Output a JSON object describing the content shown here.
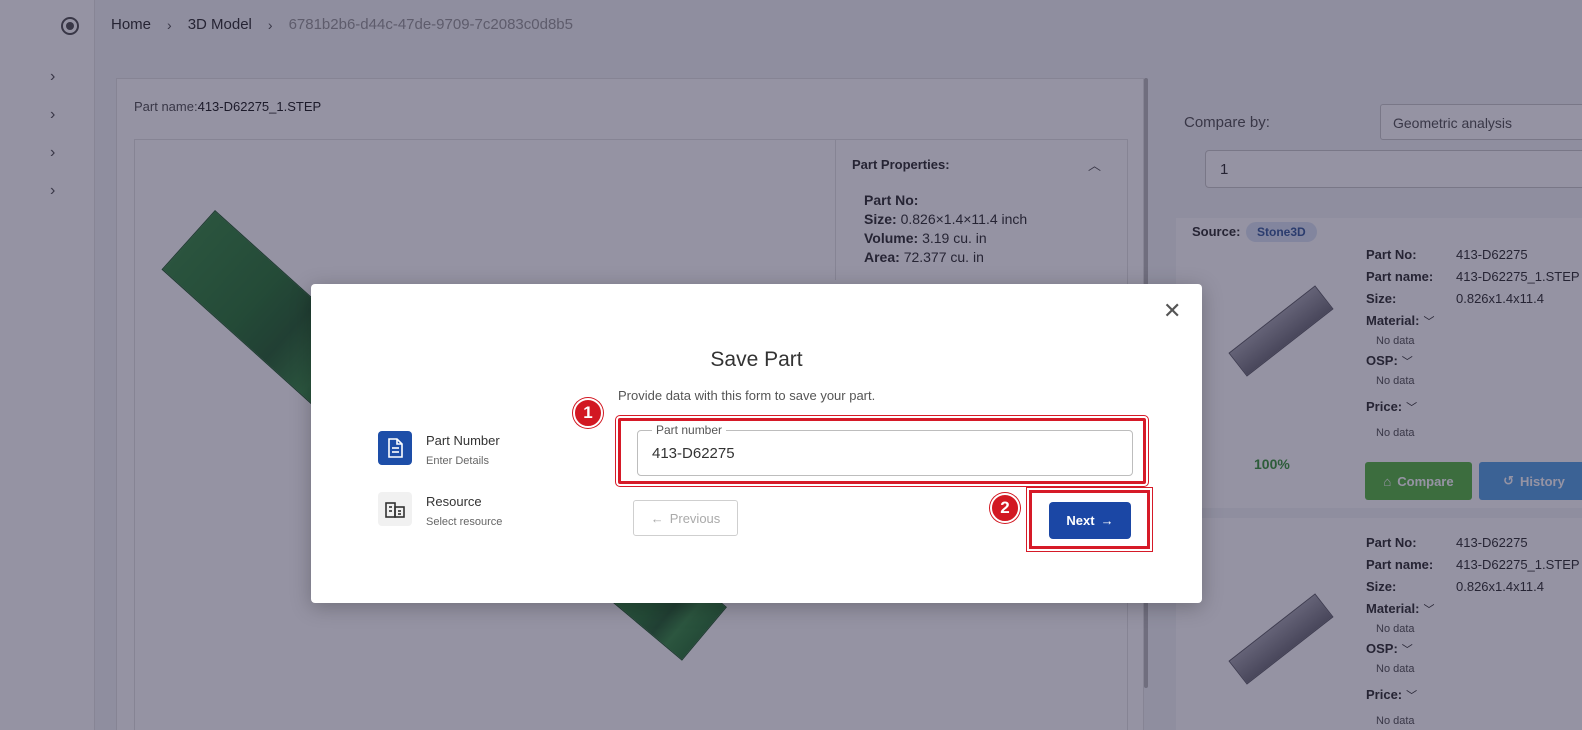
{
  "breadcrumb": {
    "home": "Home",
    "model": "3D Model",
    "current": "6781b2b6-d44c-47de-9709-7c2083c0d8b5"
  },
  "main": {
    "part_name_label": "Part name:",
    "part_name_value": "413-D62275_1.STEP",
    "properties": {
      "title": "Part Properties:",
      "part_no": "Part No:",
      "size": "Size:",
      "size_value": "0.826×1.4×11.4 inch",
      "volume": "Volume:",
      "volume_value": "3.19 cu. in",
      "area": "Area:",
      "area_value": "72.377 cu. in"
    }
  },
  "right_panel": {
    "compare_by_label": "Compare by:",
    "compare_by_value": "Geometric analysis",
    "count_value": "1",
    "source_label": "Source:",
    "source_badge": "Stone3D",
    "results": [
      {
        "part_no_label": "Part No:",
        "part_no": "413-D62275",
        "part_name_label": "Part name:",
        "part_name": "413-D62275_1.STEP",
        "size_label": "Size:",
        "size": "0.826x1.4x11.4",
        "material_label": "Material:",
        "material": "No data",
        "osp_label": "OSP:",
        "osp": "No data",
        "price_label": "Price:",
        "price": "No data",
        "match": "100%",
        "compare_label": "Compare",
        "history_label": "History"
      },
      {
        "part_no_label": "Part No:",
        "part_no": "413-D62275",
        "part_name_label": "Part name:",
        "part_name": "413-D62275_1.STEP",
        "size_label": "Size:",
        "size": "0.826x1.4x11.4",
        "material_label": "Material:",
        "material": "No data",
        "osp_label": "OSP:",
        "osp": "No data",
        "price_label": "Price:",
        "price": "No data"
      }
    ]
  },
  "modal": {
    "title": "Save Part",
    "subtitle": "Provide data with this form to save your part.",
    "steps": [
      {
        "title": "Part Number",
        "subtitle": "Enter Details",
        "icon": "document-icon"
      },
      {
        "title": "Resource",
        "subtitle": "Select resource",
        "icon": "building-icon"
      }
    ],
    "field_label": "Part number",
    "field_value": "413-D62275",
    "previous_label": "Previous",
    "next_label": "Next",
    "markers": [
      "1",
      "2"
    ]
  },
  "colors": {
    "primary": "#1b47a5",
    "annotation_red": "#d21822",
    "compare_green": "#5cb945",
    "history_blue": "#5aa4e6",
    "model_green": "#3b8b45"
  }
}
